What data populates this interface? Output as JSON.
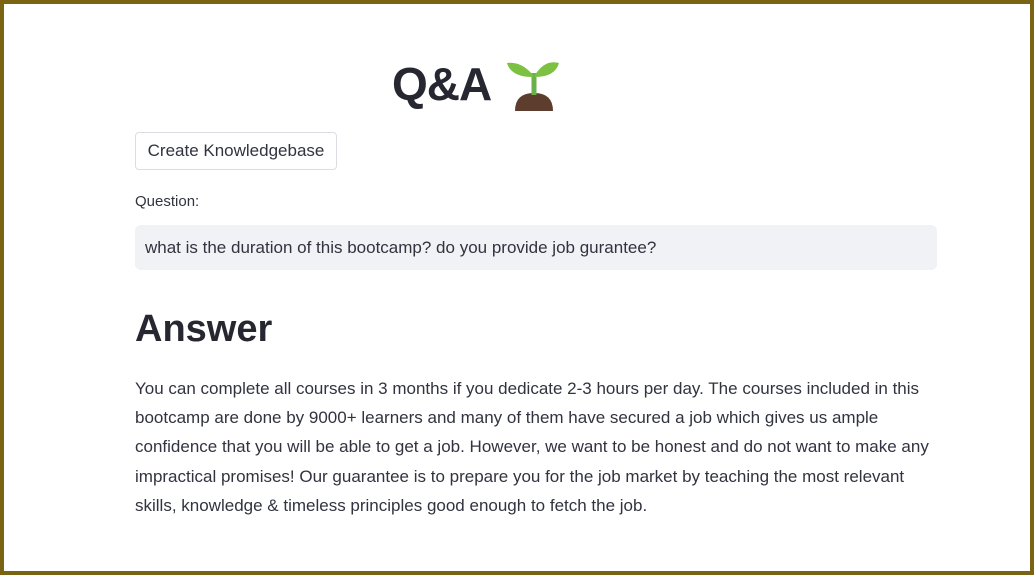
{
  "header": {
    "title": "Q&A",
    "title_icon": "seedling-icon"
  },
  "knowledgebase": {
    "button_label": "Create Knowledgebase"
  },
  "question": {
    "label": "Question:",
    "value": "what is the duration of this bootcamp? do you provide job gurantee?"
  },
  "answer": {
    "heading": "Answer",
    "text": "You can complete all courses in 3 months if you dedicate 2-3 hours per day. The courses included in this bootcamp are done by 9000+ learners and many of them have secured a job which gives us ample confidence that you will be able to get a job. However, we want to be honest and do not want to make any impractical promises! Our guarantee is to prepare you for the job market by teaching the most relevant skills, knowledge & timeless principles good enough to fetch the job."
  },
  "colors": {
    "frame_border": "#7a6413",
    "input_background": "#f0f2f6",
    "text": "#31333f",
    "sprout_leaf": "#7cc142",
    "soil": "#5c3d2e"
  }
}
